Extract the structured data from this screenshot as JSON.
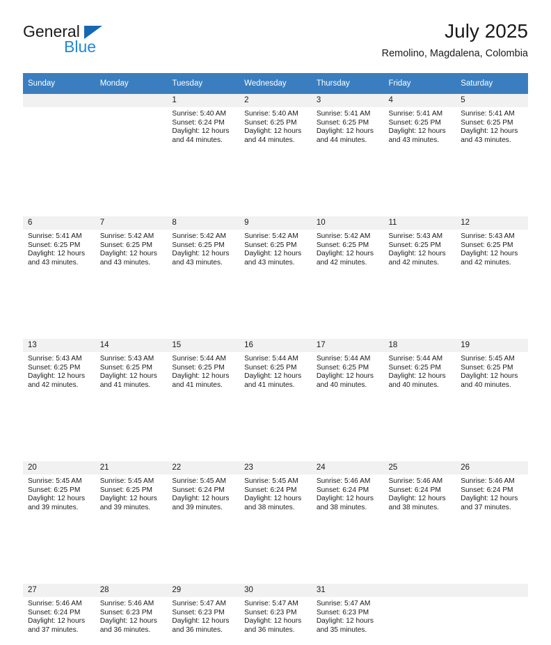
{
  "brand": {
    "name_top": "General",
    "name_bottom": "Blue",
    "triangle_color": "#1668b3",
    "blue_color": "#2387d6"
  },
  "header": {
    "title": "July 2025",
    "subtitle": "Remolino, Magdalena, Colombia"
  },
  "theme": {
    "header_bg": "#3a7ebf",
    "header_text": "#ffffff",
    "daynum_bg": "#f1f1f1",
    "cell_bg": "#ffffff",
    "text": "#1a1a1a"
  },
  "weekday_headers": [
    "Sunday",
    "Monday",
    "Tuesday",
    "Wednesday",
    "Thursday",
    "Friday",
    "Saturday"
  ],
  "labels": {
    "sunrise_prefix": "Sunrise: ",
    "sunset_prefix": "Sunset: ",
    "daylight_prefix": "Daylight: "
  },
  "weeks": [
    [
      {
        "day": "",
        "empty": true
      },
      {
        "day": "",
        "empty": true
      },
      {
        "day": "1",
        "sunrise": "Sunrise: 5:40 AM",
        "sunset": "Sunset: 6:24 PM",
        "daylight_line1": "Daylight: 12 hours",
        "daylight_line2": "and 44 minutes."
      },
      {
        "day": "2",
        "sunrise": "Sunrise: 5:40 AM",
        "sunset": "Sunset: 6:25 PM",
        "daylight_line1": "Daylight: 12 hours",
        "daylight_line2": "and 44 minutes."
      },
      {
        "day": "3",
        "sunrise": "Sunrise: 5:41 AM",
        "sunset": "Sunset: 6:25 PM",
        "daylight_line1": "Daylight: 12 hours",
        "daylight_line2": "and 44 minutes."
      },
      {
        "day": "4",
        "sunrise": "Sunrise: 5:41 AM",
        "sunset": "Sunset: 6:25 PM",
        "daylight_line1": "Daylight: 12 hours",
        "daylight_line2": "and 43 minutes."
      },
      {
        "day": "5",
        "sunrise": "Sunrise: 5:41 AM",
        "sunset": "Sunset: 6:25 PM",
        "daylight_line1": "Daylight: 12 hours",
        "daylight_line2": "and 43 minutes."
      }
    ],
    [
      {
        "day": "6",
        "sunrise": "Sunrise: 5:41 AM",
        "sunset": "Sunset: 6:25 PM",
        "daylight_line1": "Daylight: 12 hours",
        "daylight_line2": "and 43 minutes."
      },
      {
        "day": "7",
        "sunrise": "Sunrise: 5:42 AM",
        "sunset": "Sunset: 6:25 PM",
        "daylight_line1": "Daylight: 12 hours",
        "daylight_line2": "and 43 minutes."
      },
      {
        "day": "8",
        "sunrise": "Sunrise: 5:42 AM",
        "sunset": "Sunset: 6:25 PM",
        "daylight_line1": "Daylight: 12 hours",
        "daylight_line2": "and 43 minutes."
      },
      {
        "day": "9",
        "sunrise": "Sunrise: 5:42 AM",
        "sunset": "Sunset: 6:25 PM",
        "daylight_line1": "Daylight: 12 hours",
        "daylight_line2": "and 43 minutes."
      },
      {
        "day": "10",
        "sunrise": "Sunrise: 5:42 AM",
        "sunset": "Sunset: 6:25 PM",
        "daylight_line1": "Daylight: 12 hours",
        "daylight_line2": "and 42 minutes."
      },
      {
        "day": "11",
        "sunrise": "Sunrise: 5:43 AM",
        "sunset": "Sunset: 6:25 PM",
        "daylight_line1": "Daylight: 12 hours",
        "daylight_line2": "and 42 minutes."
      },
      {
        "day": "12",
        "sunrise": "Sunrise: 5:43 AM",
        "sunset": "Sunset: 6:25 PM",
        "daylight_line1": "Daylight: 12 hours",
        "daylight_line2": "and 42 minutes."
      }
    ],
    [
      {
        "day": "13",
        "sunrise": "Sunrise: 5:43 AM",
        "sunset": "Sunset: 6:25 PM",
        "daylight_line1": "Daylight: 12 hours",
        "daylight_line2": "and 42 minutes."
      },
      {
        "day": "14",
        "sunrise": "Sunrise: 5:43 AM",
        "sunset": "Sunset: 6:25 PM",
        "daylight_line1": "Daylight: 12 hours",
        "daylight_line2": "and 41 minutes."
      },
      {
        "day": "15",
        "sunrise": "Sunrise: 5:44 AM",
        "sunset": "Sunset: 6:25 PM",
        "daylight_line1": "Daylight: 12 hours",
        "daylight_line2": "and 41 minutes."
      },
      {
        "day": "16",
        "sunrise": "Sunrise: 5:44 AM",
        "sunset": "Sunset: 6:25 PM",
        "daylight_line1": "Daylight: 12 hours",
        "daylight_line2": "and 41 minutes."
      },
      {
        "day": "17",
        "sunrise": "Sunrise: 5:44 AM",
        "sunset": "Sunset: 6:25 PM",
        "daylight_line1": "Daylight: 12 hours",
        "daylight_line2": "and 40 minutes."
      },
      {
        "day": "18",
        "sunrise": "Sunrise: 5:44 AM",
        "sunset": "Sunset: 6:25 PM",
        "daylight_line1": "Daylight: 12 hours",
        "daylight_line2": "and 40 minutes."
      },
      {
        "day": "19",
        "sunrise": "Sunrise: 5:45 AM",
        "sunset": "Sunset: 6:25 PM",
        "daylight_line1": "Daylight: 12 hours",
        "daylight_line2": "and 40 minutes."
      }
    ],
    [
      {
        "day": "20",
        "sunrise": "Sunrise: 5:45 AM",
        "sunset": "Sunset: 6:25 PM",
        "daylight_line1": "Daylight: 12 hours",
        "daylight_line2": "and 39 minutes."
      },
      {
        "day": "21",
        "sunrise": "Sunrise: 5:45 AM",
        "sunset": "Sunset: 6:25 PM",
        "daylight_line1": "Daylight: 12 hours",
        "daylight_line2": "and 39 minutes."
      },
      {
        "day": "22",
        "sunrise": "Sunrise: 5:45 AM",
        "sunset": "Sunset: 6:24 PM",
        "daylight_line1": "Daylight: 12 hours",
        "daylight_line2": "and 39 minutes."
      },
      {
        "day": "23",
        "sunrise": "Sunrise: 5:45 AM",
        "sunset": "Sunset: 6:24 PM",
        "daylight_line1": "Daylight: 12 hours",
        "daylight_line2": "and 38 minutes."
      },
      {
        "day": "24",
        "sunrise": "Sunrise: 5:46 AM",
        "sunset": "Sunset: 6:24 PM",
        "daylight_line1": "Daylight: 12 hours",
        "daylight_line2": "and 38 minutes."
      },
      {
        "day": "25",
        "sunrise": "Sunrise: 5:46 AM",
        "sunset": "Sunset: 6:24 PM",
        "daylight_line1": "Daylight: 12 hours",
        "daylight_line2": "and 38 minutes."
      },
      {
        "day": "26",
        "sunrise": "Sunrise: 5:46 AM",
        "sunset": "Sunset: 6:24 PM",
        "daylight_line1": "Daylight: 12 hours",
        "daylight_line2": "and 37 minutes."
      }
    ],
    [
      {
        "day": "27",
        "sunrise": "Sunrise: 5:46 AM",
        "sunset": "Sunset: 6:24 PM",
        "daylight_line1": "Daylight: 12 hours",
        "daylight_line2": "and 37 minutes."
      },
      {
        "day": "28",
        "sunrise": "Sunrise: 5:46 AM",
        "sunset": "Sunset: 6:23 PM",
        "daylight_line1": "Daylight: 12 hours",
        "daylight_line2": "and 36 minutes."
      },
      {
        "day": "29",
        "sunrise": "Sunrise: 5:47 AM",
        "sunset": "Sunset: 6:23 PM",
        "daylight_line1": "Daylight: 12 hours",
        "daylight_line2": "and 36 minutes."
      },
      {
        "day": "30",
        "sunrise": "Sunrise: 5:47 AM",
        "sunset": "Sunset: 6:23 PM",
        "daylight_line1": "Daylight: 12 hours",
        "daylight_line2": "and 36 minutes."
      },
      {
        "day": "31",
        "sunrise": "Sunrise: 5:47 AM",
        "sunset": "Sunset: 6:23 PM",
        "daylight_line1": "Daylight: 12 hours",
        "daylight_line2": "and 35 minutes."
      },
      {
        "day": "",
        "empty": true
      },
      {
        "day": "",
        "empty": true
      }
    ]
  ]
}
